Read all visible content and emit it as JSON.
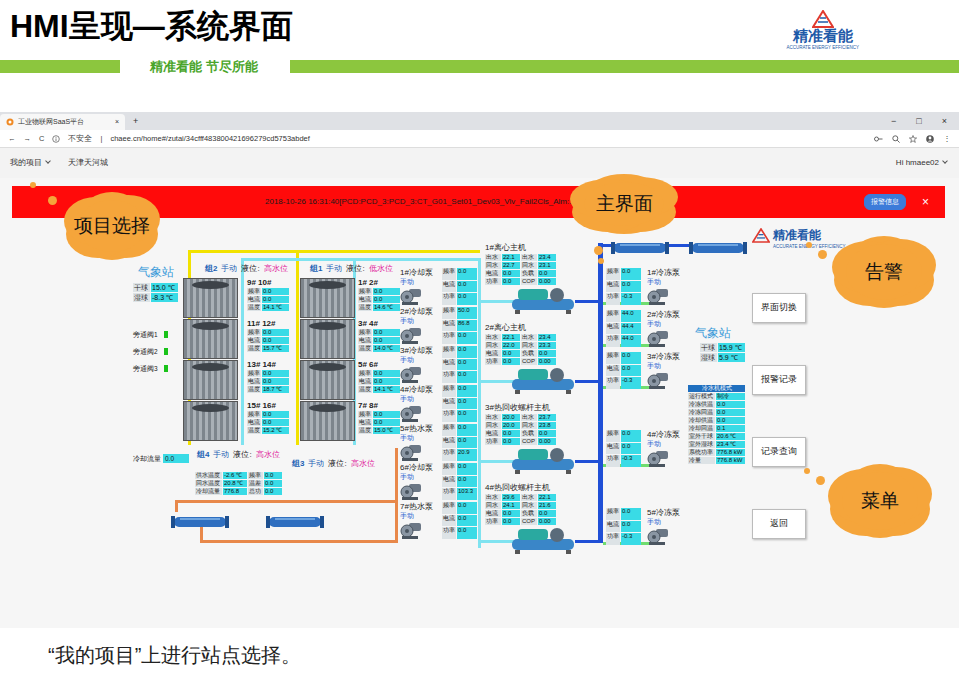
{
  "slide": {
    "title": "HMI呈现—系统界面",
    "slogan": "精准看能 节尽所能",
    "caption": "“我的项目”上进行站点选择。",
    "logo": {
      "name": "精准看能",
      "subtitle": "ACCURATE ENERGY EFFICIENCY"
    }
  },
  "browser": {
    "tab": {
      "title": "工业物联网SaaS平台",
      "close": "×"
    },
    "new_tab": "+",
    "window_buttons": [
      "−",
      "□",
      "×"
    ],
    "nav": [
      "←",
      "→",
      "C"
    ],
    "address": {
      "security": "不安全",
      "separator": "|",
      "url": "chaee.cn/home#/zutai/34cfff483800421696279cd5753abdef"
    },
    "toolbar_menu": "⋮"
  },
  "app": {
    "project_menu": "我的项目",
    "site": "天津天河城",
    "user": "Hi hmaee02"
  },
  "alarm": {
    "text": "2018-10-26 16:31:40[PCD:PCD_3:PCD_3:CT_G01_Set01_Dev03_Vlv_Fail2Cls_Alm:1] 1#冷却塔",
    "button": "报警信息",
    "close": "×"
  },
  "callouts": [
    {
      "label": "项目选择"
    },
    {
      "label": "主界面"
    },
    {
      "label": "告警"
    },
    {
      "label": "菜单"
    }
  ],
  "diagram": {
    "logo": {
      "name": "精准看能",
      "subtitle": "ACCURATE ENERGY EFFICIENCY"
    },
    "weather_stations": [
      {
        "title": "气象站",
        "rows": [
          [
            "干球",
            "15.0 ℃"
          ],
          [
            "湿球",
            "-8.3 ℃"
          ]
        ]
      },
      {
        "title": "气象站",
        "rows": [
          [
            "干球",
            "15.9 ℃"
          ],
          [
            "湿球",
            "5.9 ℃"
          ]
        ]
      }
    ],
    "tower_groups": [
      {
        "name": "组2",
        "mode": "手动",
        "level_label": "液位:",
        "level": "高水位"
      },
      {
        "name": "组1",
        "mode": "手动",
        "level_label": "液位:",
        "level": "低水位"
      },
      {
        "name": "组4",
        "mode": "手动",
        "level_label": "液位:",
        "level": "高水位"
      },
      {
        "name": "组3",
        "mode": "手动",
        "level_label": "液位:",
        "level": "高水位"
      }
    ],
    "tower_columns": [
      {
        "towers": [
          {
            "label": "9# 10#",
            "rows": [
              [
                "频率",
                "0.0"
              ],
              [
                "电流",
                "0.0"
              ],
              [
                "温度",
                "14.1 ℃"
              ]
            ]
          },
          {
            "label": "11# 12#",
            "rows": [
              [
                "频率",
                "0.0"
              ],
              [
                "电流",
                "0.0"
              ],
              [
                "温度",
                "15.7 ℃"
              ]
            ]
          },
          {
            "label": "13# 14#",
            "rows": [
              [
                "频率",
                "0.0"
              ],
              [
                "电流",
                "0.0"
              ],
              [
                "温度",
                "18.7 ℃"
              ]
            ]
          },
          {
            "label": "15# 16#",
            "rows": [
              [
                "频率",
                "0.0"
              ],
              [
                "电流",
                "0.0"
              ],
              [
                "温度",
                "15.2 ℃"
              ]
            ]
          }
        ]
      },
      {
        "towers": [
          {
            "label": "1# 2#",
            "rows": [
              [
                "频率",
                "0.0"
              ],
              [
                "电流",
                "0.0"
              ],
              [
                "温度",
                "14.6 ℃"
              ]
            ]
          },
          {
            "label": "3# 4#",
            "rows": [
              [
                "频率",
                "0.0"
              ],
              [
                "电流",
                "0.0"
              ],
              [
                "温度",
                "14.0 ℃"
              ]
            ]
          },
          {
            "label": "5# 6#",
            "rows": [
              [
                "频率",
                "0.0"
              ],
              [
                "电流",
                "0.0"
              ],
              [
                "温度",
                "14.1 ℃"
              ]
            ]
          },
          {
            "label": "7# 8#",
            "rows": [
              [
                "频率",
                "0.0"
              ],
              [
                "电流",
                "0.0"
              ],
              [
                "温度",
                "15.0 ℃"
              ]
            ]
          }
        ]
      }
    ],
    "valves": [
      {
        "label": "旁通阀1",
        "on": true
      },
      {
        "label": "旁通阀2",
        "on": true
      },
      {
        "label": "旁通阀3",
        "on": true
      }
    ],
    "cooling_flow": {
      "label": "冷却流量",
      "value": "0.0"
    },
    "summary_left": {
      "rows": [
        [
          "供水温度",
          "-2.6 ℃",
          "频率",
          "0.0"
        ],
        [
          "回水温度",
          "20.8 ℃",
          "温差",
          "0.0"
        ],
        [
          "冷却流量",
          "776.8",
          "总功",
          "0.0"
        ]
      ]
    },
    "pumps": [
      {
        "label": "1#冷却泵",
        "mode": "手动",
        "rows": [
          [
            "频率",
            "0.0"
          ],
          [
            "电流",
            "0.0"
          ],
          [
            "功率",
            "0.0"
          ]
        ]
      },
      {
        "label": "2#冷却泵",
        "mode": "手动",
        "rows": [
          [
            "频率",
            "50.0"
          ],
          [
            "电流",
            "86.8"
          ],
          [
            "功率",
            "0.0"
          ]
        ]
      },
      {
        "label": "3#冷却泵",
        "mode": "手动",
        "rows": [
          [
            "频率",
            "0.0"
          ],
          [
            "电流",
            "0.0"
          ],
          [
            "功率",
            "0.0"
          ]
        ]
      },
      {
        "label": "4#冷却泵",
        "mode": "手动",
        "rows": [
          [
            "频率",
            "0.0"
          ],
          [
            "电流",
            "0.0"
          ],
          [
            "功率",
            "0.0"
          ]
        ]
      },
      {
        "label": "5#热水泵",
        "mode": "手动",
        "rows": [
          [
            "频率",
            "0.0"
          ],
          [
            "电流",
            "0.0"
          ],
          [
            "功率",
            "20.9"
          ]
        ]
      },
      {
        "label": "6#冷却泵",
        "mode": "手动",
        "rows": [
          [
            "频率",
            "0.0"
          ],
          [
            "电流",
            "0.0"
          ],
          [
            "功率",
            "103.3"
          ]
        ]
      },
      {
        "label": "7#热水泵",
        "mode": "手动",
        "rows": [
          [
            "频率",
            "0.0"
          ],
          [
            "电流",
            "0.0"
          ],
          [
            "功率",
            "0.0"
          ]
        ]
      }
    ],
    "chillers": [
      {
        "label": "1#离心主机",
        "rows": [
          [
            "出水",
            "22.1",
            "出水",
            "23.4"
          ],
          [
            "回水",
            "22.7",
            "回水",
            "23.1"
          ],
          [
            "电流",
            "0.0",
            "负载",
            "0.0"
          ],
          [
            "功率",
            "0.0",
            "COP",
            "0.00"
          ]
        ]
      },
      {
        "label": "2#离心主机",
        "rows": [
          [
            "出水",
            "22.1",
            "出水",
            "23.4"
          ],
          [
            "回水",
            "22.0",
            "回水",
            "23.3"
          ],
          [
            "电流",
            "0.0",
            "负载",
            "0.0"
          ],
          [
            "功率",
            "0.0",
            "COP",
            "0.00"
          ]
        ]
      },
      {
        "label": "3#热回收螺杆主机",
        "rows": [
          [
            "出水",
            "20.0",
            "出水",
            "23.7"
          ],
          [
            "回水",
            "20.0",
            "回水",
            "23.8"
          ],
          [
            "电流",
            "0.0",
            "负载",
            "0.0"
          ],
          [
            "功率",
            "0.0",
            "COP",
            "0.00"
          ]
        ]
      },
      {
        "label": "4#热回收螺杆主机",
        "rows": [
          [
            "出水",
            "29.6",
            "出水",
            "22.1"
          ],
          [
            "回水",
            "24.1",
            "回水",
            "21.6"
          ],
          [
            "电流",
            "0.0",
            "负载",
            "0.0"
          ],
          [
            "功率",
            "0.0",
            "COP",
            "0.00"
          ]
        ]
      }
    ],
    "chilled_pumps": [
      {
        "label": "1#冷冻泵",
        "mode": "手动",
        "rows": [
          [
            "频率",
            "0.0"
          ],
          [
            "电流",
            "0.0"
          ],
          [
            "功率",
            "-0.3"
          ]
        ]
      },
      {
        "label": "2#冷冻泵",
        "mode": "手动",
        "rows": [
          [
            "频率",
            "44.0"
          ],
          [
            "电流",
            "44.4"
          ],
          [
            "功率",
            "44.0"
          ]
        ]
      },
      {
        "label": "3#冷冻泵",
        "mode": "手动",
        "rows": [
          [
            "频率",
            "0.0"
          ],
          [
            "电流",
            "0.0"
          ],
          [
            "功率",
            "-0.3"
          ]
        ]
      },
      {
        "label": "4#冷冻泵",
        "mode": "手动",
        "rows": [
          [
            "频率",
            "0.0"
          ],
          [
            "电流",
            "0.0"
          ],
          [
            "功率",
            "-0.3"
          ]
        ]
      },
      {
        "label": "5#冷冻泵",
        "mode": "手动",
        "rows": [
          [
            "频率",
            "0.0"
          ],
          [
            "电流",
            "0.0"
          ],
          [
            "功率",
            "-0.3"
          ]
        ]
      }
    ],
    "mode_table": {
      "title": "冷水机模式",
      "rows": [
        [
          "运行模式",
          "制冷"
        ],
        [
          "冷冻供温",
          "0.0"
        ],
        [
          "冷冻回温",
          "0.0"
        ],
        [
          "冷却供温",
          "0.0"
        ],
        [
          "冷却回温",
          "0.1"
        ],
        [
          "室外干球",
          "20.6 ℃"
        ],
        [
          "室外湿球",
          "23.4 ℃"
        ],
        [
          "系统功率",
          "776.8 kW"
        ],
        [
          "冷量",
          "776.8 kW"
        ]
      ]
    }
  },
  "menu": [
    {
      "label": "界面切换"
    },
    {
      "label": "报警记录"
    },
    {
      "label": "记录查询"
    },
    {
      "label": "返回"
    }
  ]
}
